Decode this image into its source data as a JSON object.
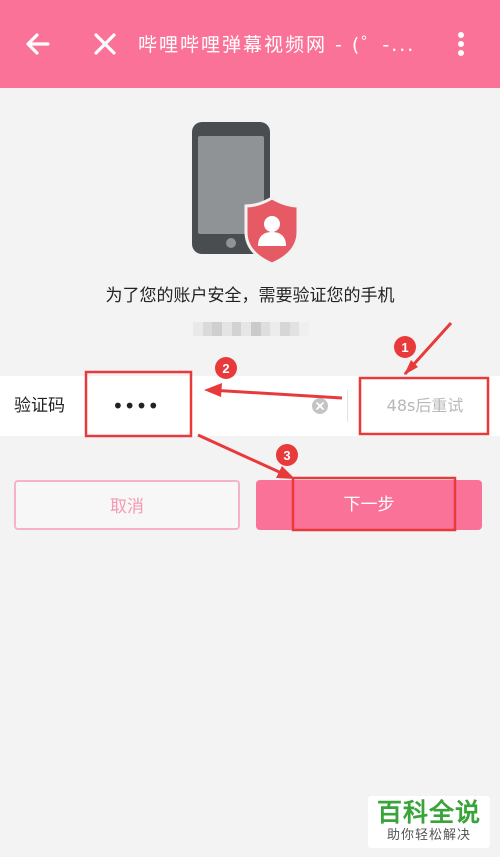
{
  "header": {
    "title": "哔哩哔哩弹幕视频网 - (゜-...",
    "back_icon": "arrow-left-icon",
    "close_icon": "close-icon",
    "menu_icon": "more-vertical-icon",
    "background": "#fb7299"
  },
  "illustration": {
    "icon": "phone-shield-user-icon"
  },
  "verification": {
    "message": "为了您的账户安全，需要验证您的手机",
    "code_label": "验证码",
    "code_value": "••••",
    "retry_label": "48s后重试"
  },
  "actions": {
    "cancel_label": "取消",
    "next_label": "下一步"
  },
  "annotations": {
    "badges": [
      "1",
      "2",
      "3"
    ],
    "color": "#e83a3a"
  },
  "watermark": {
    "title": "百科全说",
    "subtitle": "助你轻松解决"
  }
}
